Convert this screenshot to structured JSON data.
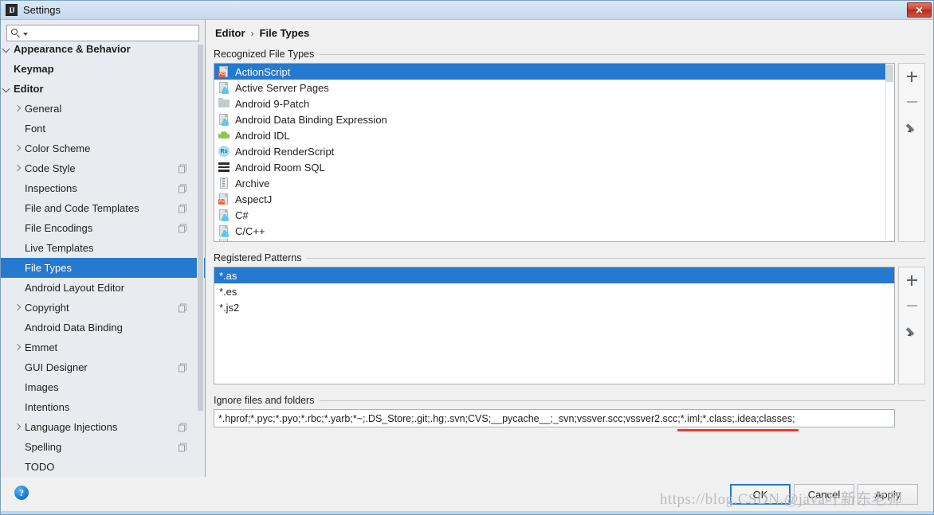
{
  "window": {
    "title": "Settings",
    "app_icon": "intellij-idea-icon",
    "close_label": "✕"
  },
  "search": {
    "value": "",
    "placeholder": "",
    "icon": "search-icon"
  },
  "sidebar": {
    "items": [
      {
        "label": "Appearance & Behavior",
        "level": 0,
        "twisty": "down",
        "bold": true,
        "badge": false,
        "selected": false
      },
      {
        "label": "Keymap",
        "level": 0,
        "twisty": "none",
        "bold": true,
        "badge": false,
        "selected": false
      },
      {
        "label": "Editor",
        "level": 0,
        "twisty": "down",
        "bold": true,
        "badge": false,
        "selected": false
      },
      {
        "label": "General",
        "level": 1,
        "twisty": "right",
        "bold": false,
        "badge": false,
        "selected": false
      },
      {
        "label": "Font",
        "level": 1,
        "twisty": "none",
        "bold": false,
        "badge": false,
        "selected": false
      },
      {
        "label": "Color Scheme",
        "level": 1,
        "twisty": "right",
        "bold": false,
        "badge": false,
        "selected": false
      },
      {
        "label": "Code Style",
        "level": 1,
        "twisty": "right",
        "bold": false,
        "badge": true,
        "selected": false
      },
      {
        "label": "Inspections",
        "level": 1,
        "twisty": "none",
        "bold": false,
        "badge": true,
        "selected": false
      },
      {
        "label": "File and Code Templates",
        "level": 1,
        "twisty": "none",
        "bold": false,
        "badge": true,
        "selected": false
      },
      {
        "label": "File Encodings",
        "level": 1,
        "twisty": "none",
        "bold": false,
        "badge": true,
        "selected": false
      },
      {
        "label": "Live Templates",
        "level": 1,
        "twisty": "none",
        "bold": false,
        "badge": false,
        "selected": false
      },
      {
        "label": "File Types",
        "level": 1,
        "twisty": "none",
        "bold": false,
        "badge": false,
        "selected": true
      },
      {
        "label": "Android Layout Editor",
        "level": 1,
        "twisty": "none",
        "bold": false,
        "badge": false,
        "selected": false
      },
      {
        "label": "Copyright",
        "level": 1,
        "twisty": "right",
        "bold": false,
        "badge": true,
        "selected": false
      },
      {
        "label": "Android Data Binding",
        "level": 1,
        "twisty": "none",
        "bold": false,
        "badge": false,
        "selected": false
      },
      {
        "label": "Emmet",
        "level": 1,
        "twisty": "right",
        "bold": false,
        "badge": false,
        "selected": false
      },
      {
        "label": "GUI Designer",
        "level": 1,
        "twisty": "none",
        "bold": false,
        "badge": true,
        "selected": false
      },
      {
        "label": "Images",
        "level": 1,
        "twisty": "none",
        "bold": false,
        "badge": false,
        "selected": false
      },
      {
        "label": "Intentions",
        "level": 1,
        "twisty": "none",
        "bold": false,
        "badge": false,
        "selected": false
      },
      {
        "label": "Language Injections",
        "level": 1,
        "twisty": "right",
        "bold": false,
        "badge": true,
        "selected": false
      },
      {
        "label": "Spelling",
        "level": 1,
        "twisty": "none",
        "bold": false,
        "badge": true,
        "selected": false
      },
      {
        "label": "TODO",
        "level": 1,
        "twisty": "none",
        "bold": false,
        "badge": false,
        "selected": false
      }
    ]
  },
  "breadcrumb": {
    "parent": "Editor",
    "separator": "›",
    "current": "File Types"
  },
  "recognized": {
    "group_label": "Recognized File Types",
    "items": [
      {
        "label": "ActionScript",
        "icon": "actionscript-file-icon",
        "selected": true
      },
      {
        "label": "Active Server Pages",
        "icon": "asp-file-icon",
        "selected": false
      },
      {
        "label": "Android 9-Patch",
        "icon": "folder-icon",
        "selected": false
      },
      {
        "label": "Android Data Binding Expression",
        "icon": "databinding-file-icon",
        "selected": false
      },
      {
        "label": "Android IDL",
        "icon": "android-robot-icon",
        "selected": false
      },
      {
        "label": "Android RenderScript",
        "icon": "renderscript-icon",
        "selected": false
      },
      {
        "label": "Android Room SQL",
        "icon": "sql-table-icon",
        "selected": false
      },
      {
        "label": "Archive",
        "icon": "archive-icon",
        "selected": false
      },
      {
        "label": "AspectJ",
        "icon": "aspectj-file-icon",
        "selected": false
      },
      {
        "label": "C#",
        "icon": "csharp-file-icon",
        "selected": false
      },
      {
        "label": "C/C++",
        "icon": "cpp-file-icon",
        "selected": false
      }
    ],
    "toolbar": [
      {
        "name": "add",
        "icon": "plus-icon"
      },
      {
        "name": "remove",
        "icon": "minus-icon"
      },
      {
        "name": "edit",
        "icon": "pencil-icon"
      }
    ]
  },
  "patterns": {
    "group_label": "Registered Patterns",
    "items": [
      {
        "label": "*.as",
        "selected": true
      },
      {
        "label": "*.es",
        "selected": false
      },
      {
        "label": "*.js2",
        "selected": false
      }
    ],
    "toolbar": [
      {
        "name": "add",
        "icon": "plus-icon"
      },
      {
        "name": "remove",
        "icon": "minus-icon"
      },
      {
        "name": "edit",
        "icon": "pencil-icon"
      }
    ]
  },
  "ignore": {
    "group_label": "Ignore files and folders",
    "value": "*.hprof;*.pyc;*.pyo;*.rbc;*.yarb;*~;.DS_Store;.git;.hg;.svn;CVS;__pycache__;_svn;vssver.scc;vssver2.scc;*.iml;*.class;.idea;classes;",
    "placeholder": "",
    "highlight_color": "#f0392b",
    "highlighted_segment": "*.iml;*.class;.idea;classes;"
  },
  "footer": {
    "help_label": "?",
    "ok_label": "OK",
    "cancel_label": "Cancel",
    "apply_label": "Apply"
  },
  "watermark": {
    "text": "https://blog.CSDN.@java叶新东老师"
  },
  "colors": {
    "selection_blue": "#2579ce",
    "close_red": "#d04537",
    "underline_red": "#f0392b",
    "sidebar_bg": "#e8ecf0",
    "panel_bg": "#f0f0f0"
  }
}
